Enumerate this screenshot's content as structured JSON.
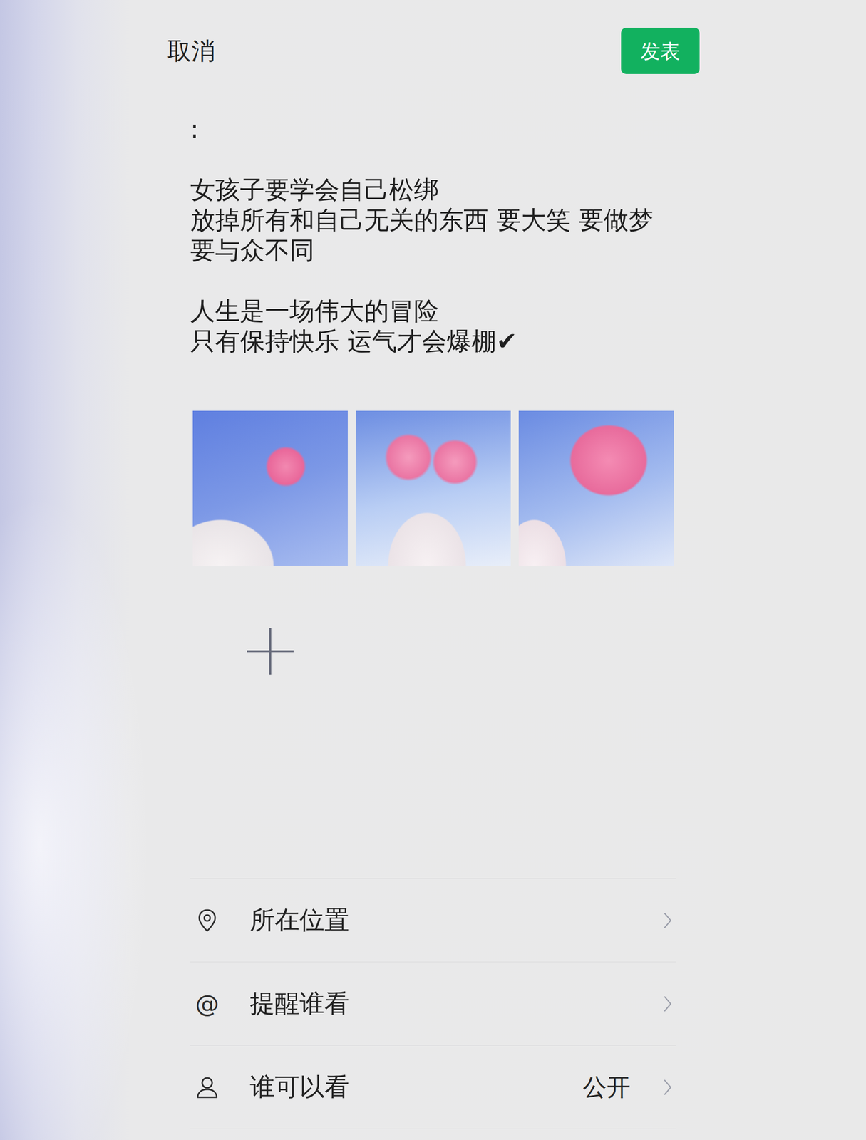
{
  "header": {
    "cancel": "取消",
    "publish": "发表"
  },
  "post": {
    "paragraphs": [
      [
        ":"
      ],
      [
        "女孩子要学会自己松绑",
        "放掉所有和自己无关的东西 要大笑 要做梦",
        "要与众不同"
      ],
      [
        "人生是一场伟大的冒险",
        "只有保持快乐 运气才会爆棚✔"
      ]
    ]
  },
  "photos": [
    {
      "kind": "single-flower"
    },
    {
      "kind": "two-flowers"
    },
    {
      "kind": "branch"
    }
  ],
  "options": [
    {
      "kind": "location",
      "label": "所在位置",
      "value": "",
      "glyph": ""
    },
    {
      "kind": "mention",
      "label": "提醒谁看",
      "value": "",
      "glyph": "@"
    },
    {
      "kind": "visibility",
      "label": "谁可以看",
      "value": "公开",
      "glyph": ""
    }
  ]
}
